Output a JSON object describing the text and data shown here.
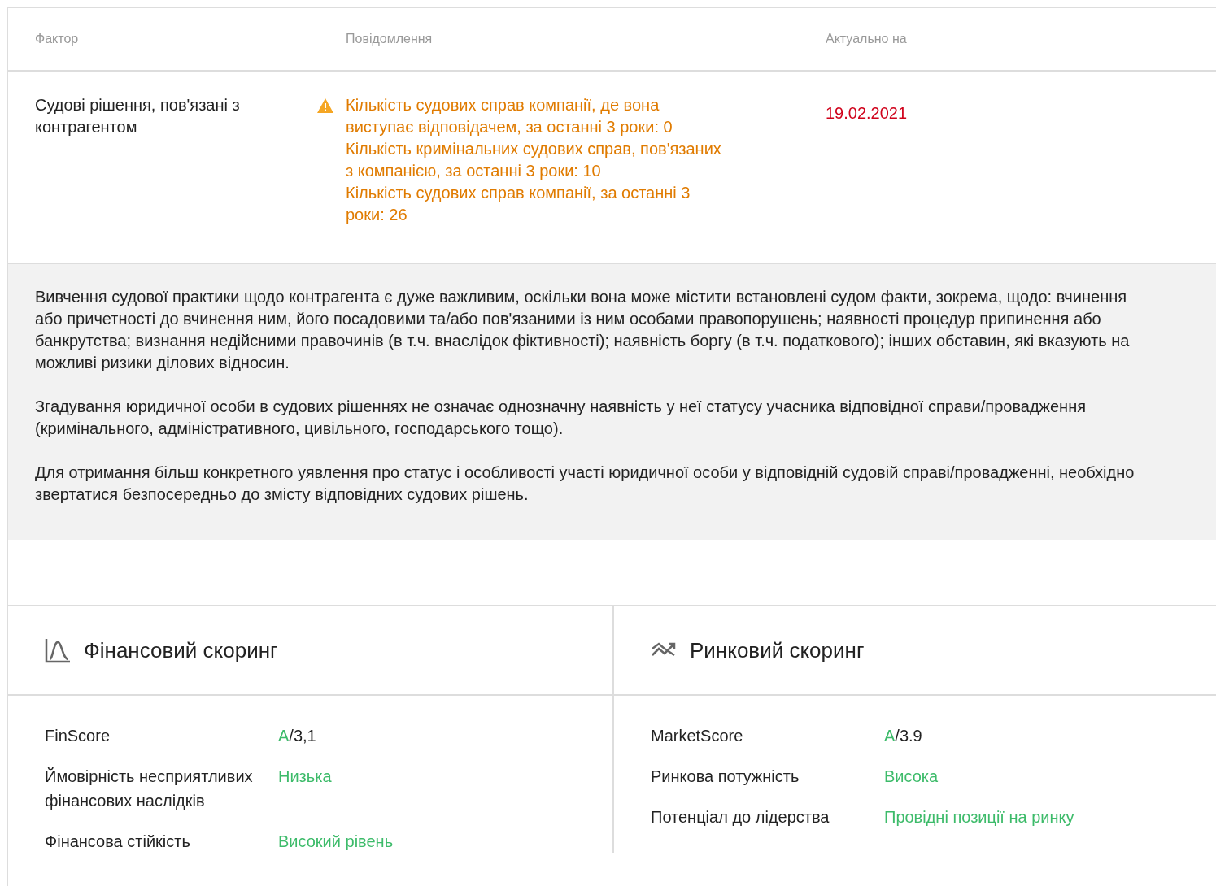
{
  "table": {
    "columns": [
      "Фактор",
      "Повідомлення",
      "Актуально на"
    ],
    "rows": [
      {
        "factor": "Судові рішення, пов'язані з контрагентом",
        "kind": "warning",
        "messages": [
          "Кількість судових справ компанії, де вона виступає відповідачем, за останні 3 роки: 0",
          "Кількість кримінальних судових справ, пов'язаних з компанією, за останні 3 роки: 10",
          "Кількість судових справ компанії, за останні 3 роки: 26"
        ],
        "date": "19.02.2021"
      }
    ]
  },
  "note": [
    "Вивчення судової практики щодо контрагента є дуже важливим, оскільки вона може містити встановлені судом факти, зокрема, щодо: вчинення або причетності до вчинення ним, його посадовими та/або пов'язаними із ним особами правопорушень; наявності процедур припинення або банкрутства; визнання недійсними правочинів (в т.ч. внаслідок фіктивності); наявність боргу (в т.ч. податкового); інших обставин, які вказують на можливі ризики ділових відносин.",
    "Згадування юридичної особи в судових рішеннях не означає однозначну наявність у неї статусу учасника відповідної справи/провадження (кримінального, адміністративного, цивільного, господарського тощо).",
    "Для отримання більш конкретного уявлення про статус і особливості участі юридичної особи у відповідній судовій справі/провадженні, необхідно звертатися безпосередньо до змісту відповідних судових рішень."
  ],
  "panels": [
    {
      "title": "Фінансовий скоринг",
      "rows": [
        {
          "label": "FinScore",
          "kind": "score",
          "grade": "A",
          "score": "/3,1"
        },
        {
          "label": "Ймовірність несприятливих фінансових наслідків",
          "kind": "status",
          "value": "Низька"
        },
        {
          "label": "Фінансова стійкість",
          "kind": "status",
          "value": "Високий рівень"
        }
      ]
    },
    {
      "title": "Ринковий скоринг",
      "rows": [
        {
          "label": "MarketScore",
          "kind": "score",
          "grade": "A",
          "score": "/3.9"
        },
        {
          "label": "Ринкова потужність",
          "kind": "status",
          "value": "Висока"
        },
        {
          "label": "Потенціал до лідерства",
          "kind": "status",
          "value": "Провідні позиції на ринку"
        }
      ]
    }
  ]
}
